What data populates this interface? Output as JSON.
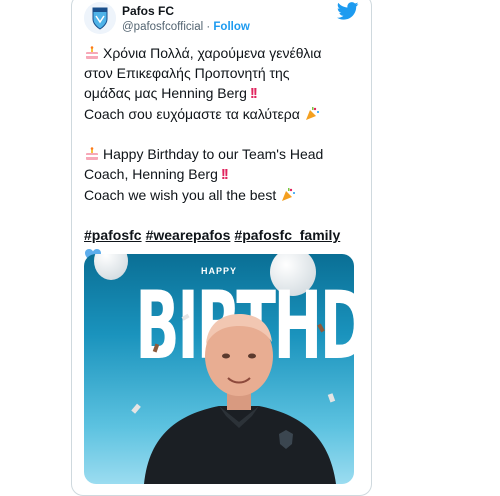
{
  "tweet": {
    "author": {
      "name": "Pafos FC",
      "handle": "@pafosfcofficial",
      "separator": "·",
      "follow_label": "Follow",
      "avatar_label": "ΠΑΦΟΣ"
    },
    "text": {
      "greek_line1": "Χρόνια Πολλά, χαρούμενα γενέθλια",
      "greek_line2": "στον Επικεφαλής Προπονητή  της",
      "greek_line3": "ομάδας μας Henning Berg",
      "greek_line4": "Coach σου ευχόμαστε τα καλύτερα",
      "english_line1": "Happy Birthday to our Team's Head",
      "english_line2": "Coach, Henning Berg",
      "english_line3": "Coach we wish you all the best",
      "bang": "!!"
    },
    "hashtags": [
      "#pafosfc",
      "#wearepafos",
      "#pafosfc_family"
    ],
    "icons": [
      "cake-icon",
      "double-exclamation-icon",
      "party-popper-icon",
      "blue-heart-icon",
      "twitter-bird-icon"
    ],
    "image": {
      "small_text": "HAPPY",
      "big_text": "BIRTHDAY"
    },
    "colors": {
      "accent": "#1d9bf0",
      "bang": "#e0245e",
      "text": "#0f1419",
      "muted": "#536471",
      "image_blue": "#1a93bd"
    }
  }
}
